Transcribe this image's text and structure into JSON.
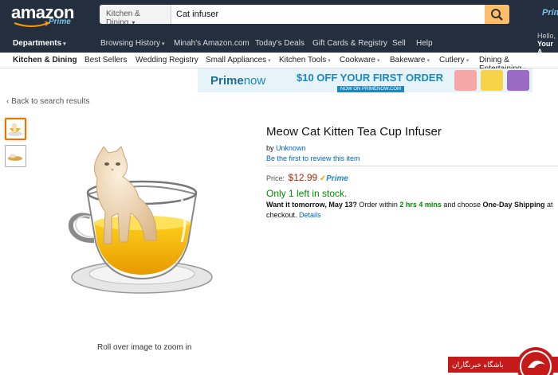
{
  "header": {
    "logo_word": "amazon",
    "logo_sub": "Prime",
    "search_category": "Kitchen & Dining",
    "search_value": "Cat infuser",
    "corner_prime": "Prime",
    "hello_line1": "Hello,",
    "hello_line2": "Your A"
  },
  "nav": {
    "departments": "Departments",
    "links": [
      "Browsing History",
      "Minah's Amazon.com",
      "Today's Deals",
      "Gift Cards & Registry",
      "Sell",
      "Help"
    ]
  },
  "subnav": {
    "items": [
      "Kitchen & Dining",
      "Best Sellers",
      "Wedding Registry",
      "Small Appliances",
      "Kitchen Tools",
      "Cookware",
      "Bakeware",
      "Cutlery",
      "Dining & Entertaining"
    ]
  },
  "banner": {
    "brand_a": "Prime",
    "brand_b": "now",
    "offer": "$10 OFF YOUR FIRST ORDER",
    "sub": "NOW ON PRIMENOW.COM"
  },
  "page": {
    "back_link": "‹ Back to search results",
    "zoom_hint": "Roll over image to zoom in"
  },
  "product": {
    "title": "Meow Cat Kitten Tea Cup Infuser",
    "by_label": "by",
    "author": "Unknown",
    "review_link": "Be the first to review this item",
    "price_label": "Price:",
    "price": "$12.99",
    "prime_check": "✓",
    "prime_word": "Prime",
    "stock": "Only 1 left in stock.",
    "ship_lead": "Want it tomorrow, May 13?",
    "ship_mid": " Order within ",
    "ship_time": "2 hrs 4 mins",
    "ship_and": " and choose ",
    "ship_option": "One-Day Shipping",
    "ship_tail": " at checkout.",
    "details_link": "Details"
  },
  "watermark": {
    "text": "باشگاه خبرنگاران"
  },
  "colors": {
    "header_bg": "#232f3e",
    "search_button": "#febd69",
    "price": "#b12704",
    "in_stock": "#008a00",
    "link": "#0066c0",
    "watermark_red": "#c41a1a"
  },
  "icons": [
    "search-icon",
    "cat-teacup-product-image",
    "thumbnail-cat-teacup",
    "thumbnail-cat-bowl",
    "watermark-logo"
  ]
}
